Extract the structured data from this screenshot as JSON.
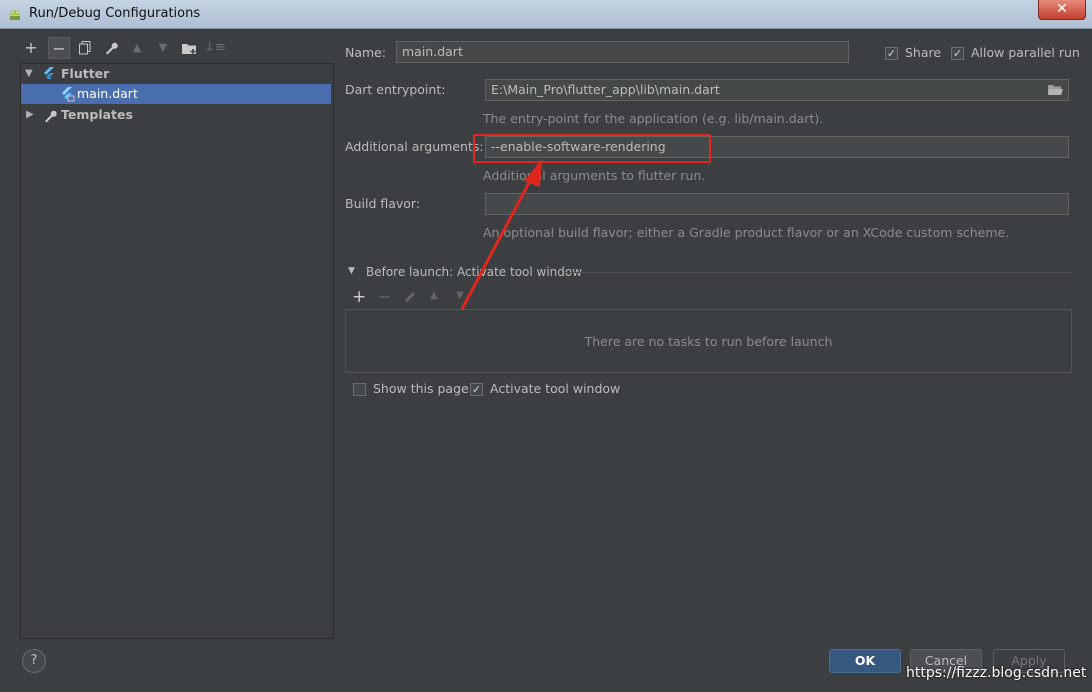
{
  "window": {
    "title": "Run/Debug Configurations",
    "close_label": "✕"
  },
  "left_toolbar": {
    "icons": [
      "add-icon",
      "remove-icon",
      "copy-icon",
      "wrench-icon",
      "move-up-icon",
      "move-down-icon",
      "folder-add-icon",
      "sort-icon"
    ]
  },
  "tree": {
    "flutter_label": "Flutter",
    "main_dart_label": "main.dart",
    "templates_label": "Templates"
  },
  "form": {
    "name_label": "Name:",
    "name_value": "main.dart",
    "share_label": "Share",
    "share_checked": true,
    "parallel_label": "Allow parallel run",
    "parallel_checked": true,
    "entrypoint_label": "Dart entrypoint:",
    "entrypoint_value": "E:\\Main_Pro\\flutter_app\\lib\\main.dart",
    "entrypoint_hint": "The entry-point for the application (e.g. lib/main.dart).",
    "args_label": "Additional arguments:",
    "args_value": "--enable-software-rendering",
    "args_hint": "Additional arguments to flutter run.",
    "flavor_label": "Build flavor:",
    "flavor_value": "",
    "flavor_hint": "An optional build flavor; either a Gradle product flavor or an XCode custom scheme."
  },
  "before_launch": {
    "title": "Before launch: Activate tool window",
    "empty_text": "There are no tasks to run before launch",
    "show_page_label": "Show this page",
    "show_page_checked": false,
    "activate_label": "Activate tool window",
    "activate_checked": true
  },
  "buttons": {
    "ok": "OK",
    "cancel": "Cancel",
    "apply": "Apply",
    "help": "?"
  },
  "watermark": "https://fizzz.blog.csdn.net",
  "colors": {
    "accent": "#4b6eaf",
    "annotation_red": "#e0261d",
    "flutter_blue": "#5bc0f8"
  }
}
